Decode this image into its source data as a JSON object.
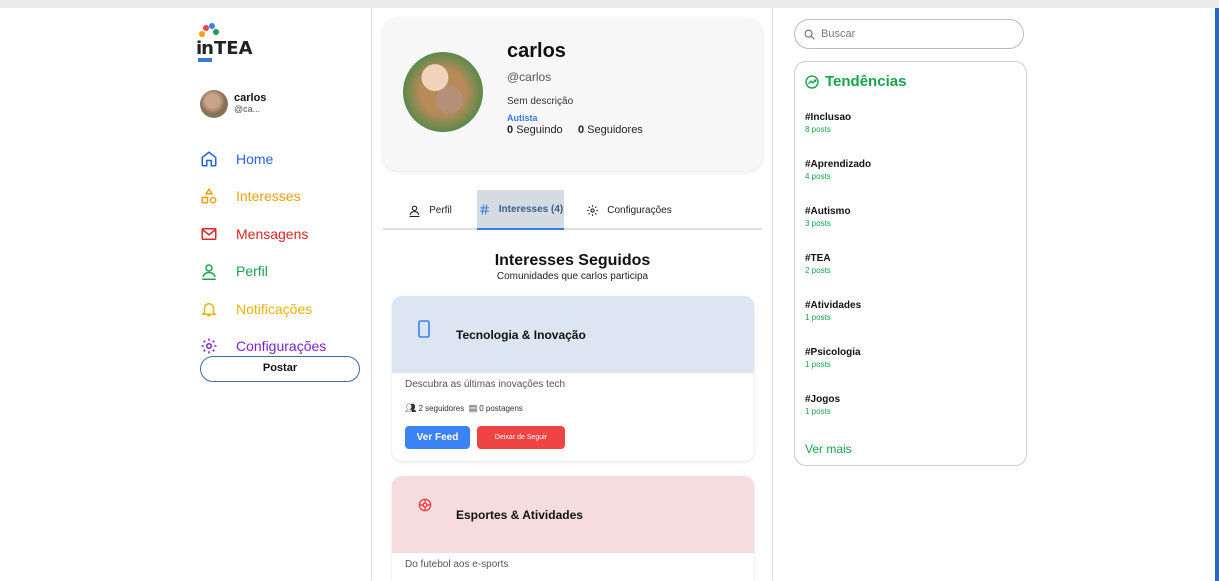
{
  "brand": {
    "logo_text_in": "in",
    "logo_text_tea": "TEA"
  },
  "user": {
    "name": "carlos",
    "handle_short": "@ca..."
  },
  "nav": [
    {
      "label": "Home",
      "icon": "home-icon",
      "color": "#2563eb"
    },
    {
      "label": "Interesses",
      "icon": "shapes-icon",
      "color": "#f59e0b"
    },
    {
      "label": "Mensagens",
      "icon": "mail-icon",
      "color": "#dc2626"
    },
    {
      "label": "Perfil",
      "icon": "user-icon",
      "color": "#16a34a"
    },
    {
      "label": "Notificações",
      "icon": "bell-icon",
      "color": "#eab308"
    },
    {
      "label": "Configurações",
      "icon": "gear-icon",
      "color": "#7e22ce"
    }
  ],
  "post_button": "Postar",
  "profile": {
    "name": "carlos",
    "handle": "@carlos",
    "description": "Sem descrição",
    "tag": "Autista",
    "following_count": "0",
    "following_label": "Seguindo",
    "followers_count": "0",
    "followers_label": "Seguidores"
  },
  "tabs": [
    {
      "label": "Perfil",
      "icon": "user-icon",
      "active": false
    },
    {
      "label": "Interesses (4)",
      "icon": "hash-icon",
      "active": true
    },
    {
      "label": "Configurações",
      "icon": "gear-icon",
      "active": false
    }
  ],
  "interests": {
    "title": "Interesses Seguidos",
    "subtitle": "Comunidades que carlos participa",
    "cards": [
      {
        "title": "Tecnologia & Inovação",
        "icon": "smartphone-icon",
        "header_color": "#dce6f3",
        "icon_color": "#3b82f6",
        "description": "Descubra as últimas inovações tech",
        "followers": "2 seguidores",
        "posts": "0 postagens",
        "feed_button": "Ver Feed",
        "unfollow_button": "Deixar de Seguir"
      },
      {
        "title": "Esportes & Atividades",
        "icon": "ball-icon",
        "header_color": "#f6dcdc",
        "icon_color": "#ef4444",
        "description": "Do futebol aos e-sports"
      }
    ]
  },
  "search": {
    "placeholder": "Buscar"
  },
  "trends": {
    "title": "Tendências",
    "items": [
      {
        "tag": "#Inclusao",
        "count": "8 posts"
      },
      {
        "tag": "#Aprendizado",
        "count": "4 posts"
      },
      {
        "tag": "#Autismo",
        "count": "3 posts"
      },
      {
        "tag": "#TEA",
        "count": "2 posts"
      },
      {
        "tag": "#Atividades",
        "count": "1 posts"
      },
      {
        "tag": "#Psicologia",
        "count": "1 posts"
      },
      {
        "tag": "#Jogos",
        "count": "1 posts"
      }
    ],
    "see_more": "Ver mais"
  }
}
